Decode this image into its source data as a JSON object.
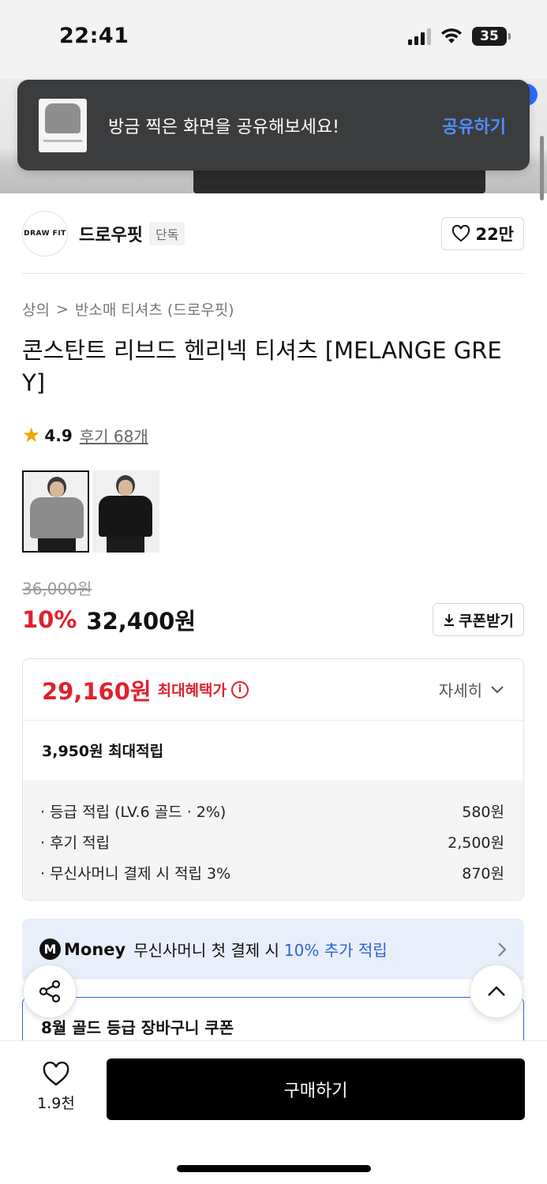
{
  "status_bar": {
    "time": "22:41",
    "battery": "35"
  },
  "toast": {
    "message": "방금 찍은 화면을 공유해보세요!",
    "action": "공유하기"
  },
  "brand": {
    "logo_text": "DRAW FIT",
    "name": "드로우핏",
    "tag": "단독",
    "likes": "22만"
  },
  "breadcrumb": {
    "category": "상의",
    "separator": ">",
    "subcategory": "반소매 티셔츠 (드로우핏)"
  },
  "product": {
    "title": "콘스탄트 리브드 헨리넥 티셔츠 [MELANGE GREY]"
  },
  "rating": {
    "score": "4.9",
    "reviews": "후기 68개"
  },
  "thumbnails": [
    {
      "color": "#8c8c8c",
      "selected": true
    },
    {
      "color": "#161616",
      "selected": false
    }
  ],
  "price": {
    "original": "36,000원",
    "discount": "10%",
    "current": "32,400원",
    "coupon_button": "쿠폰받기"
  },
  "benefit": {
    "max_price": "29,160원",
    "max_label": "최대혜택가",
    "detail_link": "자세히",
    "point_total": "3,950원 최대적립",
    "points": [
      {
        "label": "· 등급 적립 (LV.6 골드 · 2%)",
        "value": "580원"
      },
      {
        "label": "· 후기 적립",
        "value": "2,500원"
      },
      {
        "label": "· 무신사머니 결제 시 적립 3%",
        "value": "870원"
      }
    ]
  },
  "money_banner": {
    "logo": "M",
    "word": "Money",
    "text": "무신사머니 첫 결제 시",
    "accent": "10% 추가 적립"
  },
  "coupon_card": {
    "title": "8월 골드 등급 장바구니 쿠폰"
  },
  "bottom_bar": {
    "wish_count": "1.9천",
    "buy_label": "구매하기"
  },
  "colors": {
    "accent_red": "#e0212e",
    "accent_blue": "#2a64d6",
    "toast_action": "#4f8dff"
  }
}
